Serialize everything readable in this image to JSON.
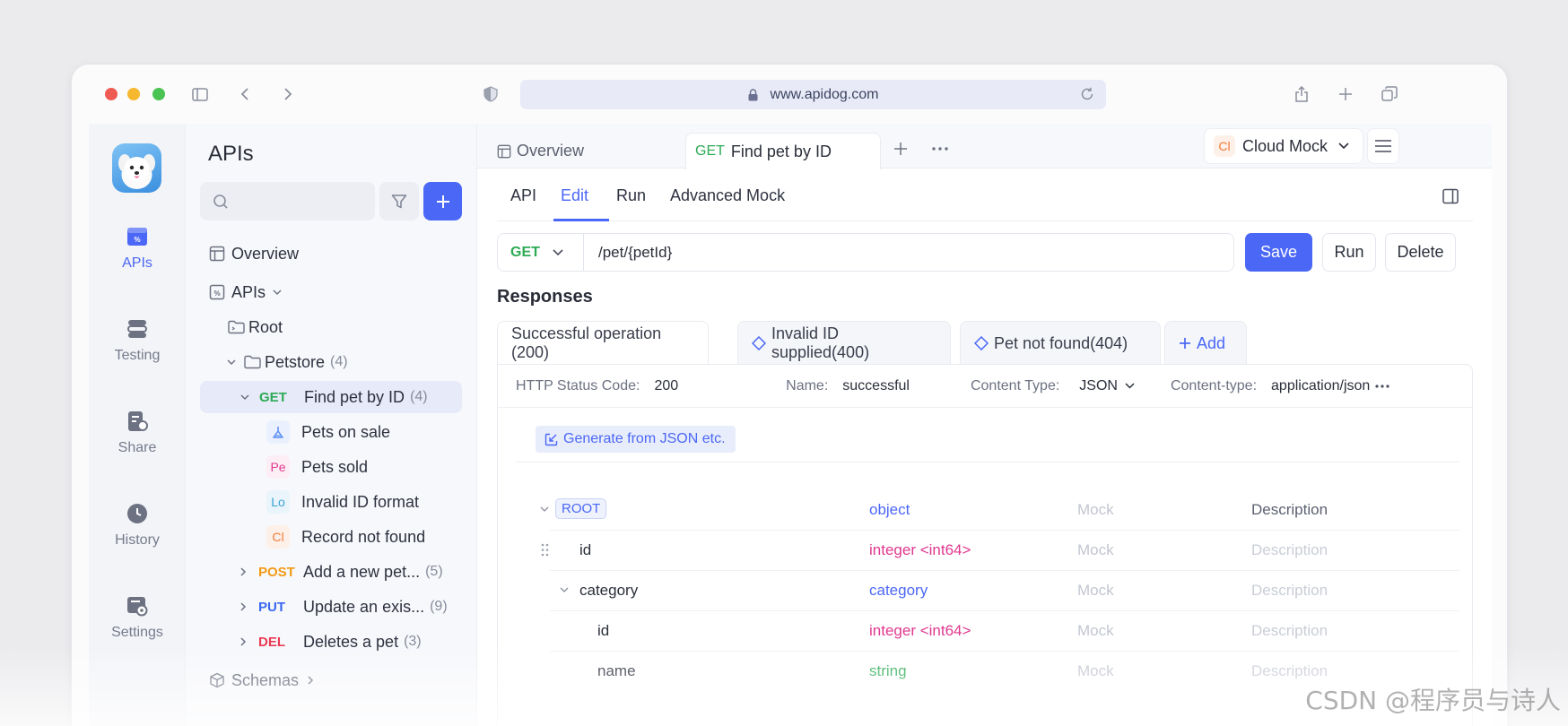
{
  "browser": {
    "url": "www.apidog.com"
  },
  "rail": {
    "items": [
      {
        "label": "APIs",
        "icon": "api-icon",
        "active": true
      },
      {
        "label": "Testing",
        "icon": "testing-icon",
        "active": false
      },
      {
        "label": "Share",
        "icon": "share-icon",
        "active": false
      },
      {
        "label": "History",
        "icon": "history-icon",
        "active": false
      },
      {
        "label": "Settings",
        "icon": "settings-icon",
        "active": false
      }
    ]
  },
  "sidebar": {
    "title": "APIs",
    "search_placeholder": "",
    "tree": {
      "overview": "Overview",
      "apis": "APIs",
      "root": "Root",
      "petstore": {
        "label": "Petstore",
        "count": "(4)"
      },
      "endpoints": [
        {
          "method": "GET",
          "label": "Find pet by ID",
          "count": "(4)",
          "selected": true
        },
        {
          "method": "POST",
          "label": "Add a new pet...",
          "count": "(5)"
        },
        {
          "method": "PUT",
          "label": "Update an exis...",
          "count": "(9)"
        },
        {
          "method": "DEL",
          "label": "Deletes a pet",
          "count": "(3)"
        }
      ],
      "mocks": [
        {
          "badge": "",
          "label": "Pets on sale",
          "color": "#5b8ef5"
        },
        {
          "badge": "Pe",
          "label": "Pets sold",
          "color": "#e0388e"
        },
        {
          "badge": "Lo",
          "label": "Invalid ID format",
          "color": "#3aa3d8"
        },
        {
          "badge": "Cl",
          "label": "Record not found",
          "color": "#f07c3a"
        }
      ],
      "schemas": "Schemas"
    }
  },
  "tabs": {
    "overview": "Overview",
    "active_method": "GET",
    "active_label": "Find pet by ID"
  },
  "env": {
    "badge": "Cl",
    "label": "Cloud Mock"
  },
  "subtabs": [
    "API",
    "Edit",
    "Run",
    "Advanced Mock"
  ],
  "request": {
    "method": "GET",
    "path": "/pet/{petId}"
  },
  "actions": {
    "save": "Save",
    "run": "Run",
    "delete": "Delete"
  },
  "responses": {
    "title": "Responses",
    "tabs": [
      "Successful operation (200)",
      "Invalid ID supplied(400)",
      "Pet not found(404)"
    ],
    "add_label": "Add",
    "meta": {
      "status_label": "HTTP Status Code:",
      "status_value": "200",
      "name_label": "Name:",
      "name_value": "successful",
      "content_type_label": "Content Type:",
      "content_type_value": "JSON",
      "content_type2_label": "Content-type:",
      "content_type2_value": "application/json"
    },
    "generate_label": "Generate from JSON etc.",
    "schema": [
      {
        "name": "ROOT",
        "type": "object",
        "mock": "Mock",
        "desc": "Description"
      },
      {
        "name": "id",
        "type": "integer <int64>",
        "mock": "Mock",
        "desc": "Description"
      },
      {
        "name": "category",
        "type": "category",
        "mock": "Mock",
        "desc": "Description"
      },
      {
        "name": "id",
        "type": "integer <int64>",
        "mock": "Mock",
        "desc": "Description"
      },
      {
        "name": "name",
        "type": "string",
        "mock": "Mock",
        "desc": "Description"
      }
    ]
  },
  "watermark": "CSDN @程序员与诗人",
  "colors": {
    "accent": "#4b67f5",
    "get": "#2eaa55",
    "post": "#f39a14",
    "put": "#3a67f0",
    "delete": "#ea3a55"
  }
}
